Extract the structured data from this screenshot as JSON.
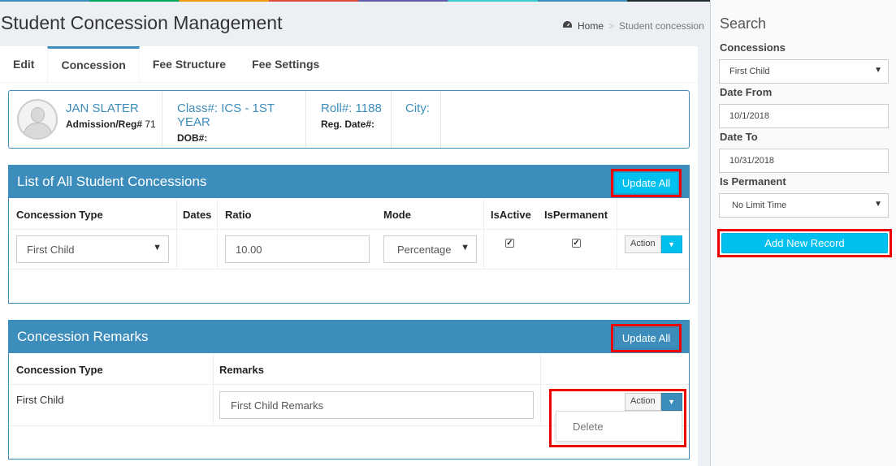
{
  "header": {
    "page_title": "Student Concession Management",
    "breadcrumb_home": "Home",
    "breadcrumb_sep": ">",
    "breadcrumb_current": "Student concession"
  },
  "tabs": [
    {
      "label": "Edit"
    },
    {
      "label": "Concession",
      "active": true
    },
    {
      "label": "Fee Structure"
    },
    {
      "label": "Fee Settings"
    }
  ],
  "student": {
    "name": "JAN SLATER",
    "admission_label": "Admission/Reg#",
    "admission_value": "71",
    "class_label": "Class#:",
    "class_value": "ICS - 1ST YEAR",
    "dob_label": "DOB#:",
    "roll_label": "Roll#:",
    "roll_value": "1188",
    "reg_date_label": "Reg. Date#:",
    "city_label": "City:"
  },
  "concessions_box": {
    "title": "List of All Student Concessions",
    "update_all_label": "Update All",
    "columns": [
      "Concession Type",
      "Dates",
      "Ratio",
      "Mode",
      "IsActive",
      "IsPermanent"
    ],
    "rows": [
      {
        "concession_type": "First Child",
        "dates": "",
        "ratio": "10.00",
        "mode": "Percentage",
        "is_active": true,
        "is_permanent": true,
        "action_label": "Action"
      }
    ]
  },
  "remarks_box": {
    "title": "Concession Remarks",
    "update_all_label": "Update All",
    "columns": [
      "Concession Type",
      "Remarks"
    ],
    "rows": [
      {
        "concession_type": "First Child",
        "remarks": "First Child Remarks",
        "action_label": "Action",
        "dropdown_items": [
          "Delete"
        ]
      }
    ]
  },
  "search_panel": {
    "title": "Search",
    "concessions_label": "Concessions",
    "concessions_value": "First Child",
    "date_from_label": "Date From",
    "date_from_value": "10/1/2018",
    "date_to_label": "Date To",
    "date_to_value": "10/31/2018",
    "is_permanent_label": "Is Permanent",
    "is_permanent_value": "No Limit Time",
    "add_new_label": "Add New Record"
  },
  "icons": {
    "home": "dashboard-icon",
    "dropdown": "caret-down-icon",
    "check": "check-icon",
    "avatar": "user-avatar-icon"
  },
  "colors": {
    "primary": "#3c8dbc",
    "info": "#00c0ef",
    "highlight": "#ee0000"
  }
}
